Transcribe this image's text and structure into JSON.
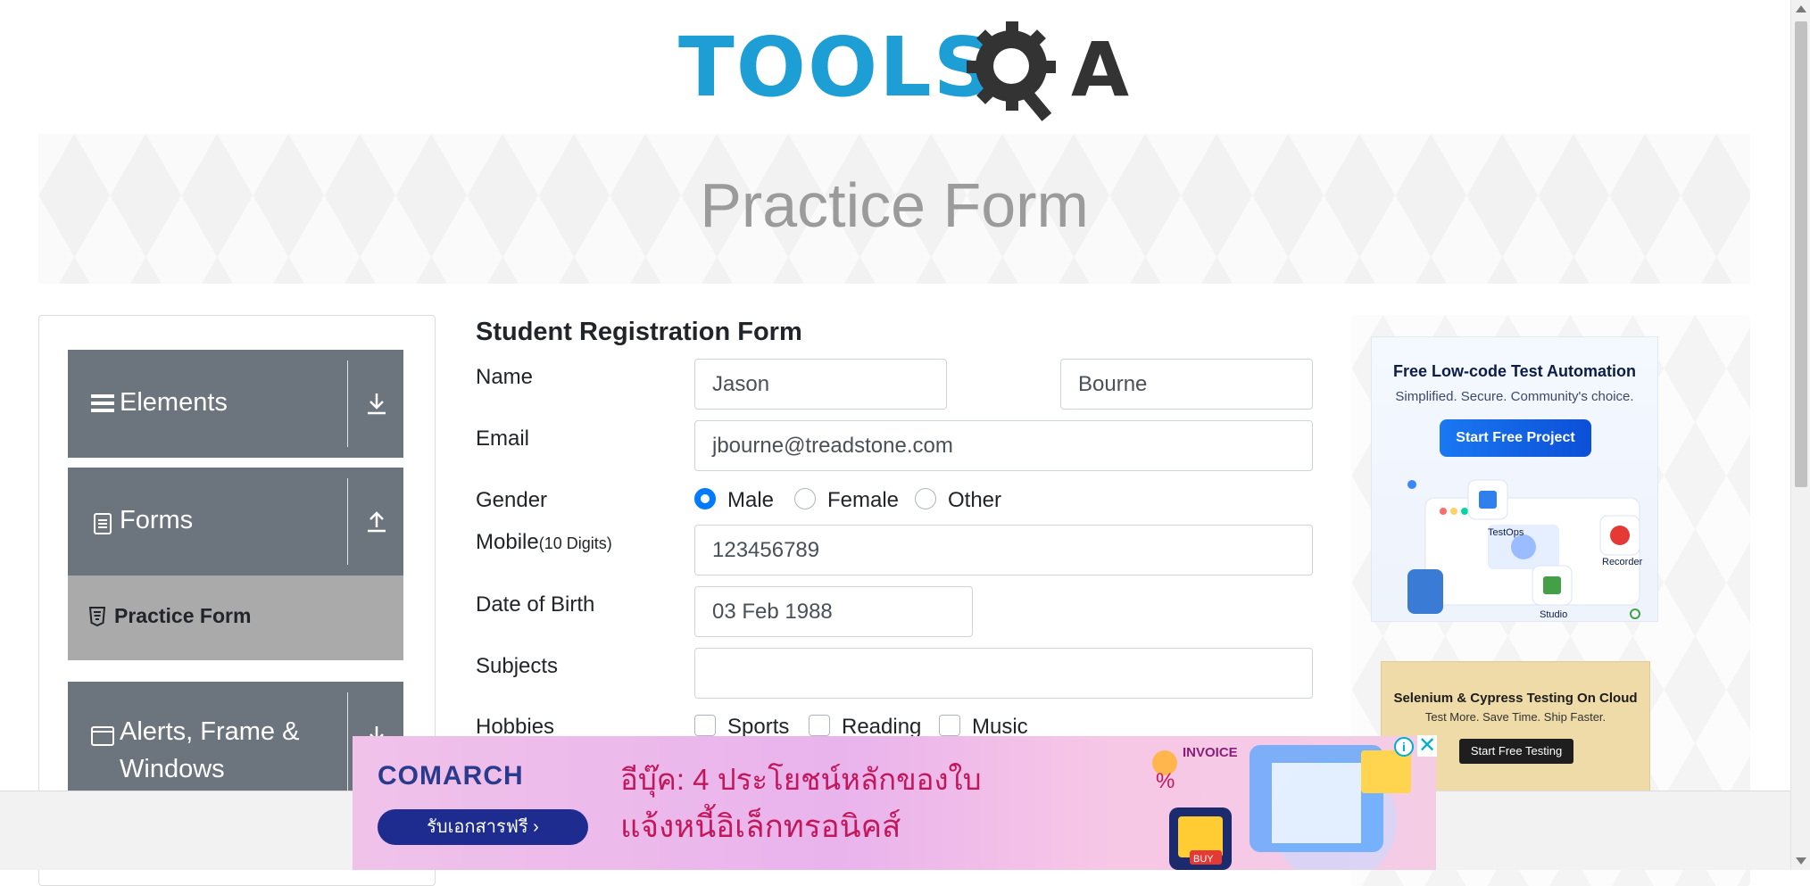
{
  "logo": {
    "text_tools": "TOOLS",
    "text_qa": "A"
  },
  "banner": {
    "title": "Practice Form"
  },
  "sidebar": {
    "groups": [
      {
        "label": "Elements",
        "icon": "hamburger-icon",
        "arrow": "download-arrow-icon"
      },
      {
        "label": "Forms",
        "icon": "document-icon",
        "arrow": "upload-arrow-icon"
      },
      {
        "label": "Alerts, Frame & Windows",
        "icon": "window-icon",
        "arrow": "download-arrow-icon"
      }
    ],
    "active_item": {
      "label": "Practice Form",
      "icon": "html5-icon"
    }
  },
  "form": {
    "title": "Student Registration Form",
    "name_label": "Name",
    "first_name": "Jason",
    "last_name": "Bourne",
    "email_label": "Email",
    "email": "jbourne@treadstone.com",
    "gender_label": "Gender",
    "gender_options": [
      "Male",
      "Female",
      "Other"
    ],
    "gender_selected": "Male",
    "mobile_label": "Mobile",
    "mobile_hint": "(10 Digits)",
    "mobile": "123456789",
    "dob_label": "Date of Birth",
    "dob": "03 Feb 1988",
    "subjects_label": "Subjects",
    "subjects": "",
    "hobbies_label": "Hobbies",
    "hobbies": [
      "Sports",
      "Reading",
      "Music"
    ]
  },
  "ads": {
    "right1": {
      "title": "Free Low-code Test Automation",
      "subtitle": "Simplified. Secure. Community's choice.",
      "button": "Start Free Project",
      "labels": [
        "TestOps",
        "Recorder",
        "Studio"
      ]
    },
    "right2": {
      "title": "Selenium & Cypress Testing On Cloud",
      "subtitle": "Test More. Save Time. Ship Faster.",
      "button": "Start Free Testing"
    },
    "bottom": {
      "brand": "COMARCH",
      "button": "รับเอกสารฟรี ›",
      "line1": "อีบุ๊ค: 4 ประโยชน์หลักของใบ",
      "line2": "แจ้งหนี้อิเล็กทรอนิคส์",
      "invoice": "INVOICE",
      "buy": "BUY"
    }
  },
  "colors": {
    "accent": "#007bff",
    "sidebar_group": "#6c757d",
    "sidebar_active": "#aaaaaa",
    "logo_blue": "#1d9fd6"
  }
}
